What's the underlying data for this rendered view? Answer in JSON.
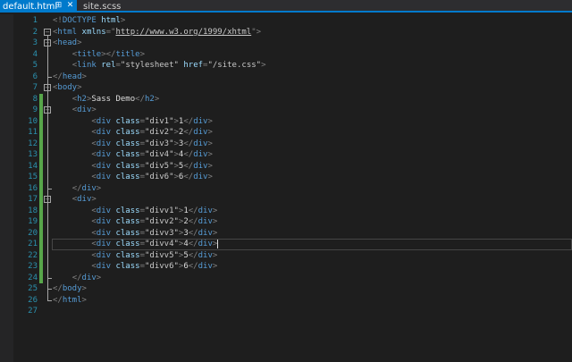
{
  "tabs": [
    {
      "label": "default.html",
      "active": true
    },
    {
      "label": "site.scss",
      "active": false
    }
  ],
  "icons": {
    "pin": "pin-icon",
    "close": "close-icon",
    "fold": "fold-toggle-icon"
  },
  "colors": {
    "accent": "#007acc",
    "change_marker": "#57a64a",
    "line_number": "#2b91af",
    "tag": "#569cd6",
    "attribute": "#9cdcfe"
  },
  "editor": {
    "current_line": 21,
    "lines": [
      {
        "n": "1",
        "text": "<!DOCTYPE html>",
        "seg": [
          [
            "p",
            "<!"
          ],
          [
            "doc",
            "DOCTYPE"
          ],
          [
            "txt",
            " "
          ],
          [
            "attr",
            "html"
          ],
          [
            "p",
            ">"
          ]
        ]
      },
      {
        "n": "2",
        "text": "<html xmlns=\"http://www.w3.org/1999/xhtml\">",
        "seg": [
          [
            "p",
            "<"
          ],
          [
            "tag",
            "html"
          ],
          [
            "txt",
            " "
          ],
          [
            "attr",
            "xmlns"
          ],
          [
            "p",
            "="
          ],
          [
            "p",
            "\""
          ],
          [
            "link",
            "http://www.w3.org/1999/xhtml"
          ],
          [
            "p",
            "\""
          ],
          [
            "p",
            ">"
          ]
        ]
      },
      {
        "n": "3",
        "text": "<head>",
        "seg": [
          [
            "p",
            "<"
          ],
          [
            "tag",
            "head"
          ],
          [
            "p",
            ">"
          ]
        ]
      },
      {
        "n": "4",
        "text": "    <title></title>",
        "seg": [
          [
            "txt",
            "    "
          ],
          [
            "p",
            "<"
          ],
          [
            "tag",
            "title"
          ],
          [
            "p",
            "></"
          ],
          [
            "tag",
            "title"
          ],
          [
            "p",
            ">"
          ]
        ]
      },
      {
        "n": "5",
        "text": "    <link rel=\"stylesheet\" href=\"/site.css\">",
        "seg": [
          [
            "txt",
            "    "
          ],
          [
            "p",
            "<"
          ],
          [
            "tag",
            "link"
          ],
          [
            "txt",
            " "
          ],
          [
            "attr",
            "rel"
          ],
          [
            "p",
            "="
          ],
          [
            "val",
            "\"stylesheet\""
          ],
          [
            "txt",
            " "
          ],
          [
            "attr",
            "href"
          ],
          [
            "p",
            "="
          ],
          [
            "val",
            "\"/site.css\""
          ],
          [
            "p",
            ">"
          ]
        ]
      },
      {
        "n": "6",
        "text": "</head>",
        "seg": [
          [
            "p",
            "</"
          ],
          [
            "tag",
            "head"
          ],
          [
            "p",
            ">"
          ]
        ]
      },
      {
        "n": "7",
        "text": "<body>",
        "seg": [
          [
            "p",
            "<"
          ],
          [
            "tag",
            "body"
          ],
          [
            "p",
            ">"
          ]
        ]
      },
      {
        "n": "8",
        "text": "    <h2>Sass Demo</h2>",
        "seg": [
          [
            "txt",
            "    "
          ],
          [
            "p",
            "<"
          ],
          [
            "tag",
            "h2"
          ],
          [
            "p",
            ">"
          ],
          [
            "txt",
            "Sass Demo"
          ],
          [
            "p",
            "</"
          ],
          [
            "tag",
            "h2"
          ],
          [
            "p",
            ">"
          ]
        ]
      },
      {
        "n": "9",
        "text": "    <div>",
        "seg": [
          [
            "txt",
            "    "
          ],
          [
            "p",
            "<"
          ],
          [
            "tag",
            "div"
          ],
          [
            "p",
            ">"
          ]
        ]
      },
      {
        "n": "10",
        "text": "        <div class=\"div1\">1</div>",
        "seg": [
          [
            "txt",
            "        "
          ],
          [
            "p",
            "<"
          ],
          [
            "tag",
            "div"
          ],
          [
            "txt",
            " "
          ],
          [
            "attr",
            "class"
          ],
          [
            "p",
            "="
          ],
          [
            "val",
            "\"div1\""
          ],
          [
            "p",
            ">"
          ],
          [
            "txt",
            "1"
          ],
          [
            "p",
            "</"
          ],
          [
            "tag",
            "div"
          ],
          [
            "p",
            ">"
          ]
        ]
      },
      {
        "n": "11",
        "text": "        <div class=\"div2\">2</div>",
        "seg": [
          [
            "txt",
            "        "
          ],
          [
            "p",
            "<"
          ],
          [
            "tag",
            "div"
          ],
          [
            "txt",
            " "
          ],
          [
            "attr",
            "class"
          ],
          [
            "p",
            "="
          ],
          [
            "val",
            "\"div2\""
          ],
          [
            "p",
            ">"
          ],
          [
            "txt",
            "2"
          ],
          [
            "p",
            "</"
          ],
          [
            "tag",
            "div"
          ],
          [
            "p",
            ">"
          ]
        ]
      },
      {
        "n": "12",
        "text": "        <div class=\"div3\">3</div>",
        "seg": [
          [
            "txt",
            "        "
          ],
          [
            "p",
            "<"
          ],
          [
            "tag",
            "div"
          ],
          [
            "txt",
            " "
          ],
          [
            "attr",
            "class"
          ],
          [
            "p",
            "="
          ],
          [
            "val",
            "\"div3\""
          ],
          [
            "p",
            ">"
          ],
          [
            "txt",
            "3"
          ],
          [
            "p",
            "</"
          ],
          [
            "tag",
            "div"
          ],
          [
            "p",
            ">"
          ]
        ]
      },
      {
        "n": "13",
        "text": "        <div class=\"div4\">4</div>",
        "seg": [
          [
            "txt",
            "        "
          ],
          [
            "p",
            "<"
          ],
          [
            "tag",
            "div"
          ],
          [
            "txt",
            " "
          ],
          [
            "attr",
            "class"
          ],
          [
            "p",
            "="
          ],
          [
            "val",
            "\"div4\""
          ],
          [
            "p",
            ">"
          ],
          [
            "txt",
            "4"
          ],
          [
            "p",
            "</"
          ],
          [
            "tag",
            "div"
          ],
          [
            "p",
            ">"
          ]
        ]
      },
      {
        "n": "14",
        "text": "        <div class=\"div5\">5</div>",
        "seg": [
          [
            "txt",
            "        "
          ],
          [
            "p",
            "<"
          ],
          [
            "tag",
            "div"
          ],
          [
            "txt",
            " "
          ],
          [
            "attr",
            "class"
          ],
          [
            "p",
            "="
          ],
          [
            "val",
            "\"div5\""
          ],
          [
            "p",
            ">"
          ],
          [
            "txt",
            "5"
          ],
          [
            "p",
            "</"
          ],
          [
            "tag",
            "div"
          ],
          [
            "p",
            ">"
          ]
        ]
      },
      {
        "n": "15",
        "text": "        <div class=\"div6\">6</div>",
        "seg": [
          [
            "txt",
            "        "
          ],
          [
            "p",
            "<"
          ],
          [
            "tag",
            "div"
          ],
          [
            "txt",
            " "
          ],
          [
            "attr",
            "class"
          ],
          [
            "p",
            "="
          ],
          [
            "val",
            "\"div6\""
          ],
          [
            "p",
            ">"
          ],
          [
            "txt",
            "6"
          ],
          [
            "p",
            "</"
          ],
          [
            "tag",
            "div"
          ],
          [
            "p",
            ">"
          ]
        ]
      },
      {
        "n": "16",
        "text": "    </div>",
        "seg": [
          [
            "txt",
            "    "
          ],
          [
            "p",
            "</"
          ],
          [
            "tag",
            "div"
          ],
          [
            "p",
            ">"
          ]
        ]
      },
      {
        "n": "17",
        "text": "    <div>",
        "seg": [
          [
            "txt",
            "    "
          ],
          [
            "p",
            "<"
          ],
          [
            "tag",
            "div"
          ],
          [
            "p",
            ">"
          ]
        ]
      },
      {
        "n": "18",
        "text": "        <div class=\"divv1\">1</div>",
        "seg": [
          [
            "txt",
            "        "
          ],
          [
            "p",
            "<"
          ],
          [
            "tag",
            "div"
          ],
          [
            "txt",
            " "
          ],
          [
            "attr",
            "class"
          ],
          [
            "p",
            "="
          ],
          [
            "val",
            "\"divv1\""
          ],
          [
            "p",
            ">"
          ],
          [
            "txt",
            "1"
          ],
          [
            "p",
            "</"
          ],
          [
            "tag",
            "div"
          ],
          [
            "p",
            ">"
          ]
        ]
      },
      {
        "n": "19",
        "text": "        <div class=\"divv2\">2</div>",
        "seg": [
          [
            "txt",
            "        "
          ],
          [
            "p",
            "<"
          ],
          [
            "tag",
            "div"
          ],
          [
            "txt",
            " "
          ],
          [
            "attr",
            "class"
          ],
          [
            "p",
            "="
          ],
          [
            "val",
            "\"divv2\""
          ],
          [
            "p",
            ">"
          ],
          [
            "txt",
            "2"
          ],
          [
            "p",
            "</"
          ],
          [
            "tag",
            "div"
          ],
          [
            "p",
            ">"
          ]
        ]
      },
      {
        "n": "20",
        "text": "        <div class=\"divv3\">3</div>",
        "seg": [
          [
            "txt",
            "        "
          ],
          [
            "p",
            "<"
          ],
          [
            "tag",
            "div"
          ],
          [
            "txt",
            " "
          ],
          [
            "attr",
            "class"
          ],
          [
            "p",
            "="
          ],
          [
            "val",
            "\"divv3\""
          ],
          [
            "p",
            ">"
          ],
          [
            "txt",
            "3"
          ],
          [
            "p",
            "</"
          ],
          [
            "tag",
            "div"
          ],
          [
            "p",
            ">"
          ]
        ]
      },
      {
        "n": "21",
        "text": "        <div class=\"divv4\">4</div>",
        "seg": [
          [
            "txt",
            "        "
          ],
          [
            "p",
            "<"
          ],
          [
            "tag",
            "div"
          ],
          [
            "txt",
            " "
          ],
          [
            "attr",
            "class"
          ],
          [
            "p",
            "="
          ],
          [
            "val",
            "\"divv4\""
          ],
          [
            "p",
            ">"
          ],
          [
            "txt",
            "4"
          ],
          [
            "p",
            "</"
          ],
          [
            "tag",
            "div"
          ],
          [
            "p",
            ">"
          ]
        ]
      },
      {
        "n": "22",
        "text": "        <div class=\"divv5\">5</div>",
        "seg": [
          [
            "txt",
            "        "
          ],
          [
            "p",
            "<"
          ],
          [
            "tag",
            "div"
          ],
          [
            "txt",
            " "
          ],
          [
            "attr",
            "class"
          ],
          [
            "p",
            "="
          ],
          [
            "val",
            "\"divv5\""
          ],
          [
            "p",
            ">"
          ],
          [
            "txt",
            "5"
          ],
          [
            "p",
            "</"
          ],
          [
            "tag",
            "div"
          ],
          [
            "p",
            ">"
          ]
        ]
      },
      {
        "n": "23",
        "text": "        <div class=\"divv6\">6</div>",
        "seg": [
          [
            "txt",
            "        "
          ],
          [
            "p",
            "<"
          ],
          [
            "tag",
            "div"
          ],
          [
            "txt",
            " "
          ],
          [
            "attr",
            "class"
          ],
          [
            "p",
            "="
          ],
          [
            "val",
            "\"divv6\""
          ],
          [
            "p",
            ">"
          ],
          [
            "txt",
            "6"
          ],
          [
            "p",
            "</"
          ],
          [
            "tag",
            "div"
          ],
          [
            "p",
            ">"
          ]
        ]
      },
      {
        "n": "24",
        "text": "    </div>",
        "seg": [
          [
            "txt",
            "    "
          ],
          [
            "p",
            "</"
          ],
          [
            "tag",
            "div"
          ],
          [
            "p",
            ">"
          ]
        ]
      },
      {
        "n": "25",
        "text": "</body>",
        "seg": [
          [
            "p",
            "</"
          ],
          [
            "tag",
            "body"
          ],
          [
            "p",
            ">"
          ]
        ]
      },
      {
        "n": "26",
        "text": "</html>",
        "seg": [
          [
            "p",
            "</"
          ],
          [
            "tag",
            "html"
          ],
          [
            "p",
            ">"
          ]
        ]
      },
      {
        "n": "27",
        "text": "",
        "seg": []
      }
    ]
  }
}
